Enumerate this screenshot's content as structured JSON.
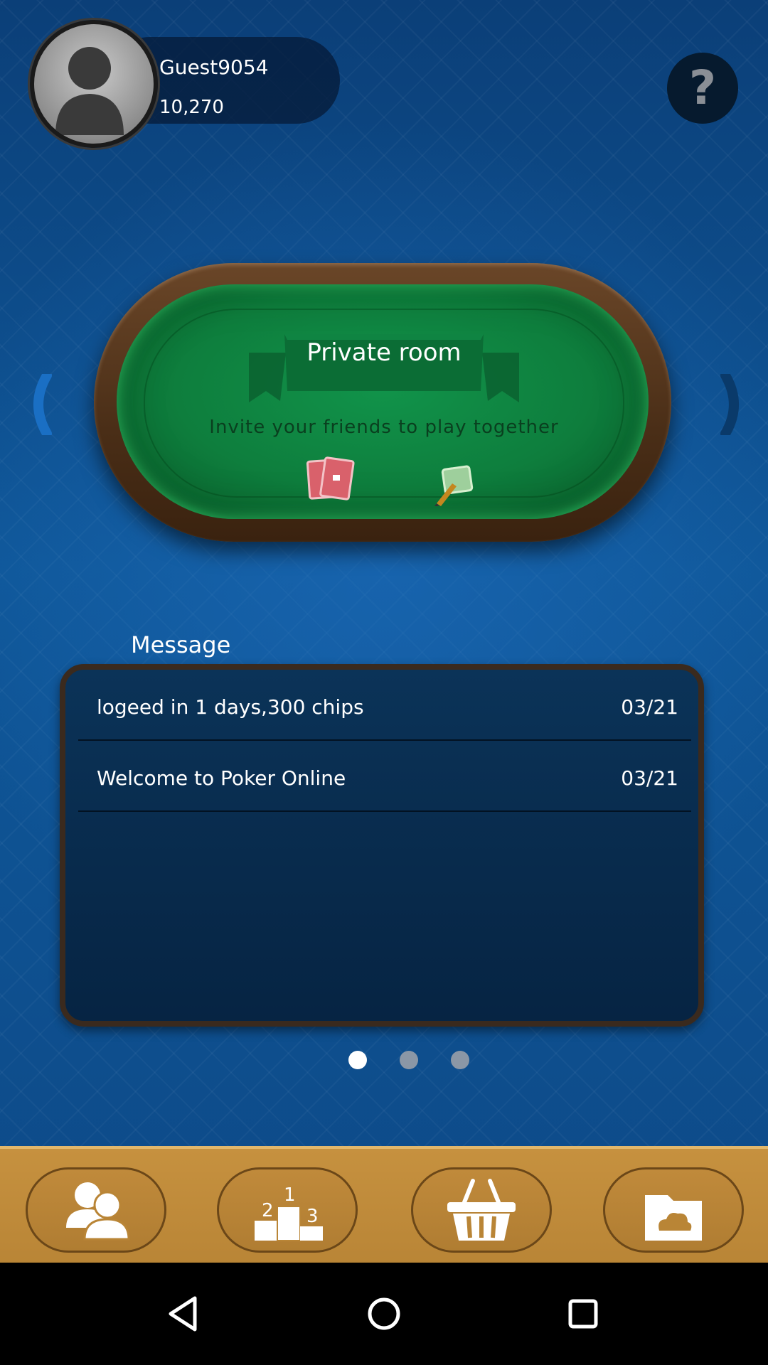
{
  "profile": {
    "username": "Guest9054",
    "chips": "10,270"
  },
  "help": {
    "label": "?"
  },
  "room": {
    "title": "Private room",
    "subtitle": "Invite your friends to play together"
  },
  "messages": {
    "heading": "Message",
    "items": [
      {
        "text": "logeed in 1 days,300 chips",
        "date": "03/21"
      },
      {
        "text": "Welcome to Poker Online",
        "date": "03/21"
      }
    ]
  },
  "pager": {
    "count": 3,
    "active_index": 0
  },
  "bottom_nav": [
    {
      "icon": "friends-icon"
    },
    {
      "icon": "leaderboard-icon"
    },
    {
      "icon": "shop-basket-icon"
    },
    {
      "icon": "cloud-folder-icon"
    }
  ],
  "colors": {
    "background": "#0f5799",
    "felt": "#0e7e3d",
    "rim": "#4a2e17",
    "bottom_bar": "#c6913f"
  }
}
